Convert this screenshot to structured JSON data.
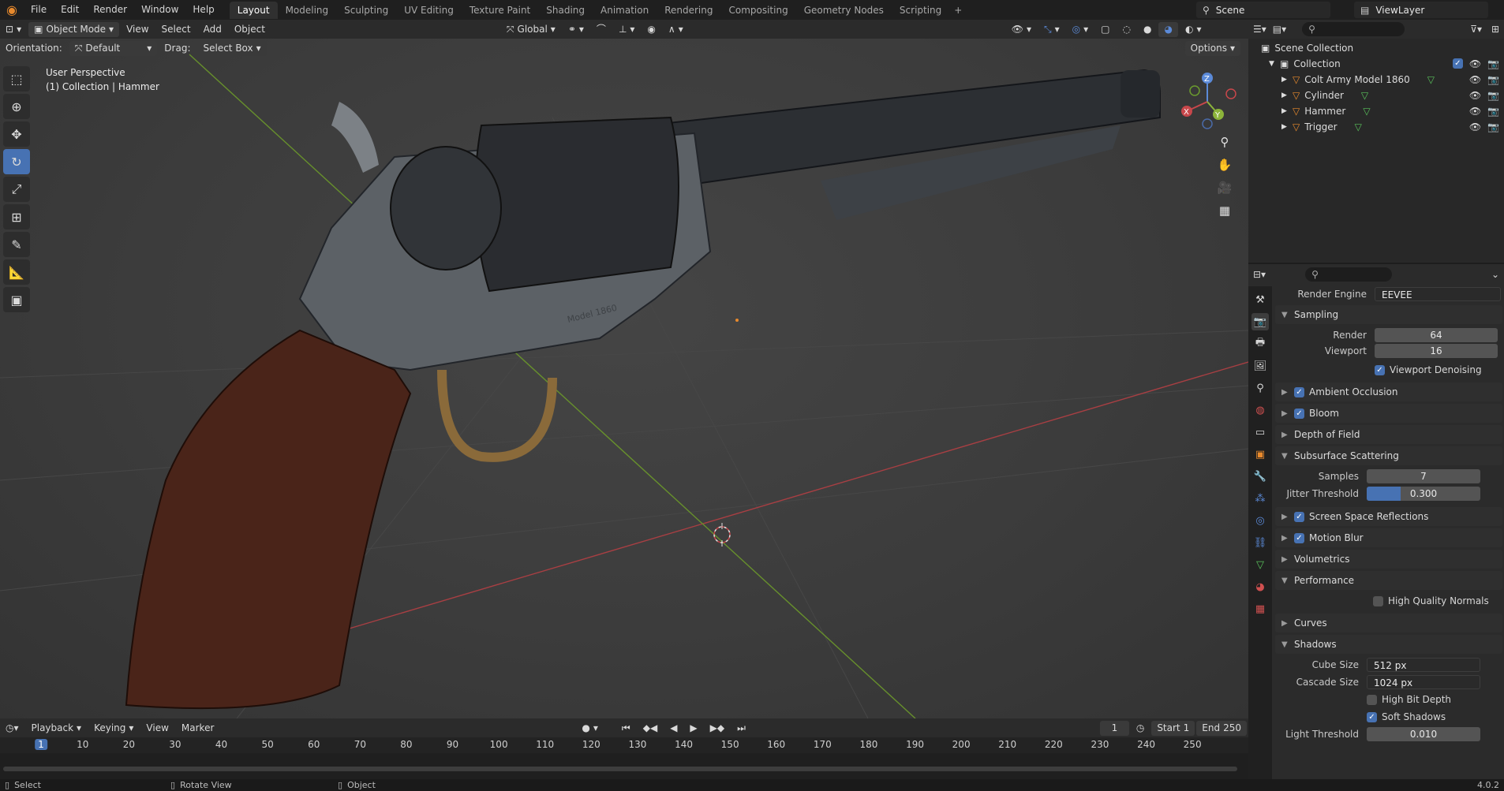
{
  "topbar": {
    "menus": [
      "File",
      "Edit",
      "Render",
      "Window",
      "Help"
    ],
    "workspaces": [
      "Layout",
      "Modeling",
      "Sculpting",
      "UV Editing",
      "Texture Paint",
      "Shading",
      "Animation",
      "Rendering",
      "Compositing",
      "Geometry Nodes",
      "Scripting"
    ],
    "active_workspace": "Layout",
    "scene": "Scene",
    "view_layer": "ViewLayer"
  },
  "viewport_header": {
    "mode": "Object Mode",
    "menus": [
      "View",
      "Select",
      "Add",
      "Object"
    ],
    "transform": "Global",
    "orientation_label": "Orientation:",
    "orientation_value": "Default",
    "drag_label": "Drag:",
    "drag_value": "Select Box",
    "options": "Options"
  },
  "viewport": {
    "perspective": "User Perspective",
    "context": "(1) Collection | Hammer",
    "engraving": "Model 1860"
  },
  "gizmo": {
    "x": "X",
    "y": "Y",
    "z": "Z"
  },
  "outliner": {
    "root": "Scene Collection",
    "collection": "Collection",
    "objects": [
      "Colt Army Model 1860",
      "Cylinder",
      "Hammer",
      "Trigger"
    ]
  },
  "properties": {
    "render_engine_label": "Render Engine",
    "render_engine": "EEVEE",
    "sampling": "Sampling",
    "render_label": "Render",
    "render_value": "64",
    "viewport_label": "Viewport",
    "viewport_value": "16",
    "viewport_denoising": "Viewport Denoising",
    "ambient_occlusion": "Ambient Occlusion",
    "bloom": "Bloom",
    "depth_of_field": "Depth of Field",
    "subsurface": "Subsurface Scattering",
    "samples_label": "Samples",
    "samples_value": "7",
    "jitter_label": "Jitter Threshold",
    "jitter_value": "0.300",
    "jitter_fraction": 0.3,
    "ssr": "Screen Space Reflections",
    "motion_blur": "Motion Blur",
    "volumetrics": "Volumetrics",
    "performance": "Performance",
    "hq_normals": "High Quality Normals",
    "curves": "Curves",
    "shadows": "Shadows",
    "cube_size_label": "Cube Size",
    "cube_size": "512 px",
    "cascade_label": "Cascade Size",
    "cascade_size": "1024 px",
    "high_bit_depth": "High Bit Depth",
    "soft_shadows": "Soft Shadows",
    "light_threshold_label": "Light Threshold",
    "light_threshold": "0.010"
  },
  "timeline": {
    "menus": [
      "Playback",
      "Keying",
      "View",
      "Marker"
    ],
    "current_frame": "1",
    "start_label": "Start",
    "start": "1",
    "end_label": "End",
    "end": "250",
    "ticks": [
      "1",
      "10",
      "20",
      "30",
      "40",
      "50",
      "60",
      "70",
      "80",
      "90",
      "100",
      "110",
      "120",
      "130",
      "140",
      "150",
      "160",
      "170",
      "180",
      "190",
      "200",
      "210",
      "220",
      "230",
      "240",
      "250"
    ]
  },
  "statusbar": {
    "select": "Select",
    "rotate": "Rotate View",
    "object": "Object",
    "version": "4.0.2"
  },
  "colors": {
    "accent": "#4772b3",
    "x_axis": "#c8474b",
    "y_axis": "#6b9b2e",
    "orange": "#e88a2d"
  }
}
